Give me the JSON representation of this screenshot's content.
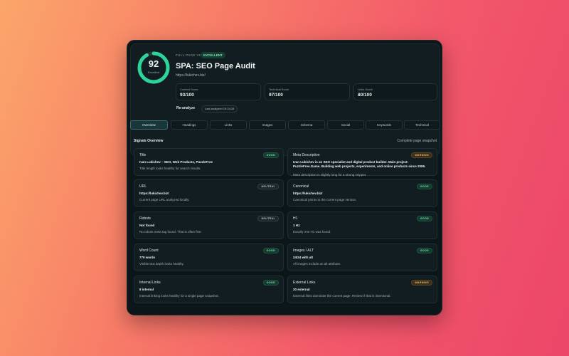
{
  "header": {
    "score": "92",
    "score_label": "Excellent",
    "score_fraction": 0.92,
    "kicker": "FULL PAGE VIEW",
    "badge": "EXCELLENT",
    "title": "SPA: SEO Page Audit",
    "url": "https://lukichev.biz/",
    "scores": [
      {
        "label": "Content Score",
        "value": "93/100"
      },
      {
        "label": "Technical Score",
        "value": "97/100"
      },
      {
        "label": "Links Score",
        "value": "80/100"
      }
    ],
    "reanalyze": "Re-analyze",
    "last_analyzed": "Last analyzed 15:24:28"
  },
  "tabs": [
    "Overview",
    "Headings",
    "Links",
    "Images",
    "Schema",
    "Social",
    "Keywords",
    "Technical"
  ],
  "signals": {
    "title": "Signals Overview",
    "subtitle": "Complete page snapshot",
    "cards": [
      {
        "label": "Title",
        "status": "GOOD",
        "value": "Ivan Lukichev – SEO, Web Products, PuzzleFree",
        "desc": "Title length looks healthy for search results."
      },
      {
        "label": "Meta Description",
        "status": "WARNING",
        "value": "Ivan Lukichev is an SEO specialist and digital product builder. Main project: PuzzleFree.Game. Building web projects, experiments, and online products since 2006.",
        "desc": "Meta description is slightly long for a strong snippet."
      },
      {
        "label": "URL",
        "status": "NEUTRAL",
        "value": "https://lukichev.biz/",
        "desc": "Current page URL analyzed locally."
      },
      {
        "label": "Canonical",
        "status": "GOOD",
        "value": "https://lukichev.biz/",
        "desc": "Canonical points to the current page version."
      },
      {
        "label": "Robots",
        "status": "NEUTRAL",
        "value": "Not found",
        "desc": "No robots meta tag found. That is often fine."
      },
      {
        "label": "H1",
        "status": "GOOD",
        "value": "1 H1",
        "desc": "Exactly one H1 was found."
      },
      {
        "label": "Word Count",
        "status": "GOOD",
        "value": "779 words",
        "desc": "Visible text depth looks healthy."
      },
      {
        "label": "Images / ALT",
        "status": "GOOD",
        "value": "24/24 with alt",
        "desc": "All images include an alt attribute."
      },
      {
        "label": "Internal Links",
        "status": "GOOD",
        "value": "8 internal",
        "desc": "Internal linking looks healthy for a single page snapshot."
      },
      {
        "label": "External Links",
        "status": "WARNING",
        "value": "20 external",
        "desc": "External links dominate the current page. Review if that is intentional."
      }
    ]
  },
  "colors": {
    "ring_fill": "#2ed39a",
    "ring_track": "#243236",
    "accent": "#3b6f72"
  }
}
